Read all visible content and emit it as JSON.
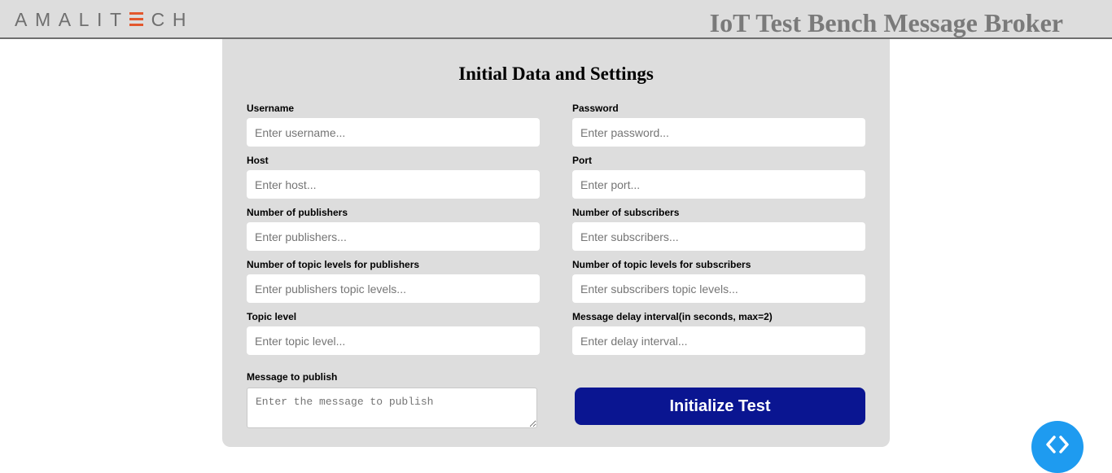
{
  "header": {
    "logo_text": "AMALITECH",
    "logo_left": "AMALIT",
    "logo_right": "CH",
    "title": "IoT Test Bench Message Broker"
  },
  "form": {
    "title": "Initial Data and Settings",
    "fields": {
      "username": {
        "label": "Username",
        "placeholder": "Enter username..."
      },
      "password": {
        "label": "Password",
        "placeholder": "Enter password..."
      },
      "host": {
        "label": "Host",
        "placeholder": "Enter host..."
      },
      "port": {
        "label": "Port",
        "placeholder": "Enter port..."
      },
      "publishers": {
        "label": "Number of publishers",
        "placeholder": "Enter publishers..."
      },
      "subscribers": {
        "label": "Number of subscribers",
        "placeholder": "Enter subscribers..."
      },
      "pub_topic_levels": {
        "label": "Number of topic levels for publishers",
        "placeholder": "Enter publishers topic levels..."
      },
      "sub_topic_levels": {
        "label": "Number of topic levels for subscribers",
        "placeholder": "Enter subscribers topic levels..."
      },
      "topic_level": {
        "label": "Topic level",
        "placeholder": "Enter topic level..."
      },
      "delay_interval": {
        "label": "Message delay interval(in seconds, max=2)",
        "placeholder": "Enter delay interval..."
      },
      "message": {
        "label": "Message to publish",
        "placeholder": "Enter the message to publish"
      }
    },
    "submit_label": "Initialize Test"
  },
  "colors": {
    "header_bg": "#dddddd",
    "panel_bg": "#dddddd",
    "logo_accent": "#e3572d",
    "button_bg": "#0a1591",
    "fab_bg": "#1e9bf0"
  },
  "icons": {
    "fab": "code-chevrons-icon"
  }
}
